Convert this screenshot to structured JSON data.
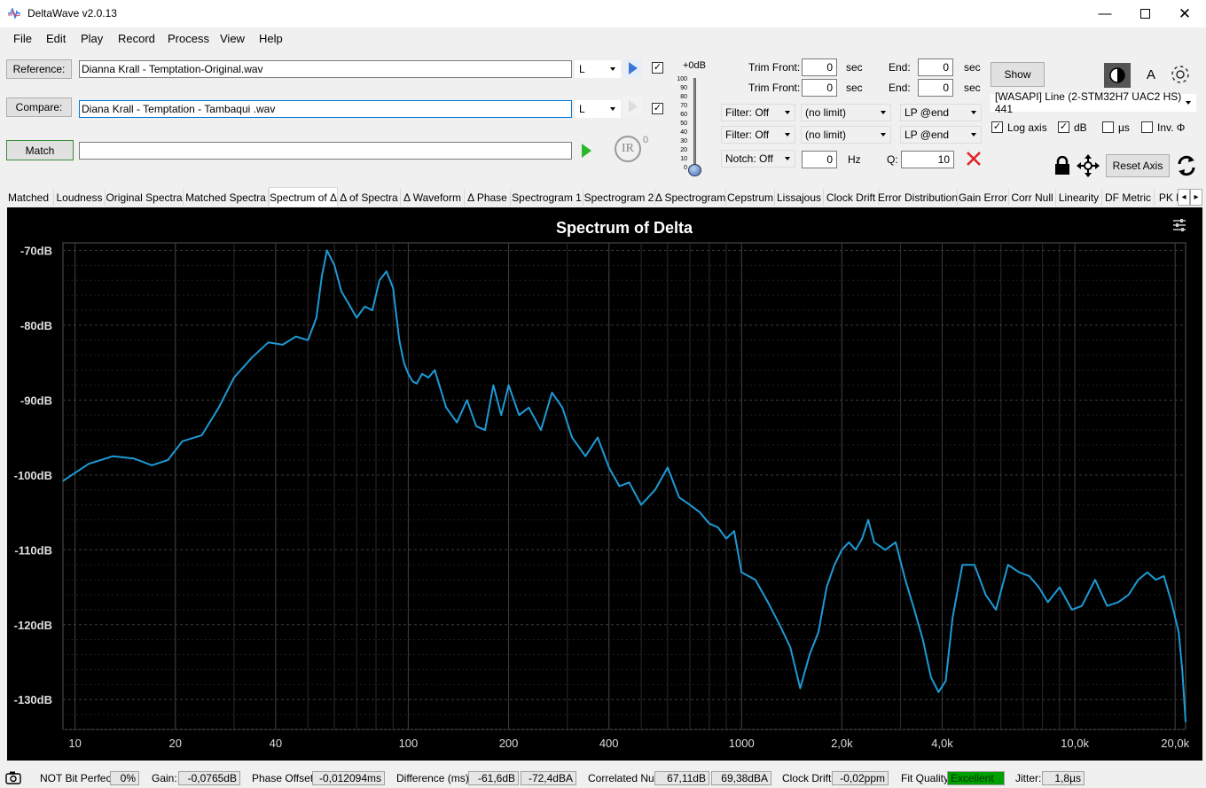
{
  "app": {
    "title": "DeltaWave v2.0.13"
  },
  "menu": [
    "File",
    "Edit",
    "Play",
    "Record",
    "Process",
    "View",
    "Help"
  ],
  "reference": {
    "label": "Reference:",
    "file": "Dianna Krall - Temptation-Original.wav",
    "channel": "L"
  },
  "compare": {
    "label": "Compare:",
    "file": "Diana Krall - Temptation - Tambaqui .wav",
    "channel": "L"
  },
  "match": {
    "label": "Match"
  },
  "ir_label": "IR",
  "ir_sup": "0",
  "volume": {
    "label": "+0dB",
    "ticks": [
      "100",
      "90",
      "80",
      "70",
      "60",
      "50",
      "40",
      "30",
      "20",
      "10",
      "0"
    ]
  },
  "trim": {
    "front_label": "Trim Front:",
    "end_label": "End:",
    "unit": "sec",
    "ref_front": "0",
    "ref_end": "0",
    "cmp_front": "0",
    "cmp_end": "0"
  },
  "filters": {
    "row1": {
      "filter": "Filter: Off",
      "limit": "(no limit)",
      "lp": "LP @end"
    },
    "row2": {
      "filter": "Filter: Off",
      "limit": "(no limit)",
      "lp": "LP @end"
    },
    "notch": "Notch: Off",
    "notch_value": "0",
    "notch_unit": "Hz",
    "q_label": "Q:",
    "q_value": "10"
  },
  "show_button": "Show",
  "font_label": "A",
  "device": "[WASAPI] Line (2-STM32H7 UAC2 HS) 441",
  "options": {
    "log_axis": "Log axis",
    "db": "dB",
    "us": "µs",
    "inv": "Inv. Φ"
  },
  "reset_axis": "Reset Axis",
  "tabs": [
    "Matched",
    "Loudness",
    "Original Spectra",
    "Matched Spectra",
    "Spectrum of Δ",
    "Δ of Spectra",
    "Δ Waveform",
    "Δ Phase",
    "Spectrogram 1",
    "Spectrogram 2",
    "Δ Spectrogram",
    "Cepstrum",
    "Lissajous",
    "Clock Drift",
    "Error Distribution",
    "Gain Error",
    "Corr Null",
    "Linearity",
    "DF Metric",
    "PK M"
  ],
  "active_tab": "Spectrum of Δ",
  "chart_data": {
    "type": "line",
    "title": "Spectrum of Delta",
    "xlabel": "",
    "ylabel": "",
    "x_scale": "log",
    "xlim": [
      9.2,
      21500
    ],
    "ylim": [
      -134,
      -69
    ],
    "x_ticks": [
      10,
      20,
      40,
      100,
      200,
      400,
      1000,
      2000,
      4000,
      10000,
      20000
    ],
    "x_tick_labels": [
      "10",
      "20",
      "40",
      "100",
      "200",
      "400",
      "1000",
      "2,0k",
      "4,0k",
      "10,0k",
      "20,0k"
    ],
    "y_ticks": [
      -70,
      -80,
      -90,
      -100,
      -110,
      -120,
      -130
    ],
    "y_tick_labels": [
      "-70dB",
      "-80dB",
      "-90dB",
      "-100dB",
      "-110dB",
      "-120dB",
      "-130dB"
    ],
    "grid": true,
    "color": "#1e9ad6",
    "series": [
      {
        "x": [
          9.2,
          11,
          13,
          15,
          17,
          19,
          21,
          24,
          27,
          30,
          34,
          38,
          42,
          46,
          50,
          53,
          55,
          57,
          60,
          63,
          66,
          70,
          74,
          78,
          82,
          86,
          90,
          94,
          97,
          100,
          103,
          106,
          110,
          115,
          120,
          130,
          140,
          150,
          160,
          170,
          180,
          190,
          200,
          215,
          230,
          250,
          270,
          290,
          310,
          340,
          370,
          400,
          430,
          460,
          500,
          550,
          600,
          650,
          700,
          750,
          800,
          850,
          900,
          950,
          1000,
          1100,
          1200,
          1300,
          1400,
          1500,
          1600,
          1700,
          1800,
          1900,
          2000,
          2100,
          2200,
          2300,
          2400,
          2500,
          2700,
          2900,
          3100,
          3300,
          3500,
          3700,
          3900,
          4100,
          4300,
          4600,
          5000,
          5400,
          5800,
          6300,
          6800,
          7300,
          7800,
          8300,
          9000,
          9800,
          10500,
          11500,
          12500,
          13500,
          14500,
          15500,
          16500,
          17500,
          18500,
          19500,
          20500,
          21000,
          21500
        ],
        "y": [
          -100.8,
          -98.5,
          -97.5,
          -97.8,
          -98.7,
          -98.0,
          -95.5,
          -94.7,
          -91.0,
          -87.0,
          -84.3,
          -82.3,
          -82.6,
          -81.5,
          -82.0,
          -79.0,
          -73.5,
          -70.0,
          -72.0,
          -75.5,
          -77.0,
          -79.0,
          -77.5,
          -78.0,
          -74.0,
          -72.8,
          -75.0,
          -82.0,
          -85.0,
          -86.5,
          -87.5,
          -87.8,
          -86.5,
          -87.0,
          -86.0,
          -91.0,
          -93.0,
          -90.0,
          -93.5,
          -94.0,
          -88.0,
          -92.0,
          -88.0,
          -92.0,
          -91.0,
          -94.0,
          -89.0,
          -91.0,
          -95.0,
          -97.5,
          -95.0,
          -99.0,
          -101.5,
          -101.0,
          -104.0,
          -102.0,
          -99.0,
          -103.0,
          -104.0,
          -105.0,
          -106.5,
          -107.0,
          -108.5,
          -107.5,
          -113.0,
          -114.0,
          -117.0,
          -120.0,
          -123.0,
          -128.5,
          -124.0,
          -121.0,
          -115.0,
          -112.0,
          -110.0,
          -109.0,
          -110.0,
          -108.5,
          -106.0,
          -109.0,
          -110.0,
          -109.0,
          -114.0,
          -118.0,
          -122.0,
          -127.0,
          -129.0,
          -127.5,
          -119.0,
          -112.0,
          -112.0,
          -116.0,
          -118.0,
          -112.0,
          -113.0,
          -113.5,
          -115.0,
          -117.0,
          -115.0,
          -118.0,
          -117.5,
          -114.0,
          -117.5,
          -117.0,
          -116.0,
          -114.0,
          -113.0,
          -114.0,
          -113.5,
          -117.0,
          -121.0,
          -126.0,
          -133.0
        ]
      }
    ]
  },
  "status": {
    "bit_perfect_label": "NOT Bit Perfect",
    "bit_perfect_value": "0%",
    "gain_label": "Gain:",
    "gain_value": "-0,0765dB",
    "phase_label": "Phase Offset:",
    "phase_value": "-0,012094ms",
    "diff_label": "Difference (ms):",
    "diff_value1": "-61,6dB",
    "diff_value2": "-72,4dBA",
    "null_label": "Correlated Null:",
    "null_value1": "67,11dB",
    "null_value2": "69,38dBA",
    "drift_label": "Clock Drift:",
    "drift_value": "-0,02ppm",
    "fit_label": "Fit Quality:",
    "fit_value": "Excellent",
    "fit_color": "#00a000",
    "jitter_label": "Jitter:",
    "jitter_value": "1,8µs"
  }
}
